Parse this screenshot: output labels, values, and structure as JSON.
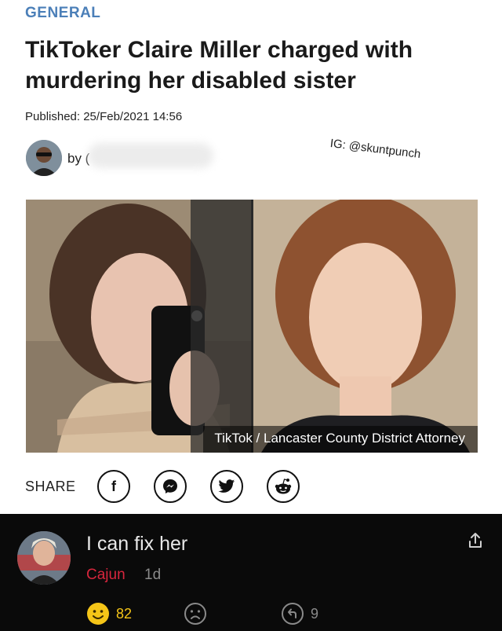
{
  "article": {
    "category": "GENERAL",
    "headline": "TikToker Claire Miller charged with murdering her disabled sister",
    "published": "Published: 25/Feb/2021 14:56",
    "byline": "by (",
    "watermark": "IG: @skuntpunch",
    "photo_caption": "TikTok / Lancaster County District Attorney"
  },
  "share": {
    "label": "SHARE",
    "buttons": [
      {
        "icon": "facebook-icon",
        "glyph": "f"
      },
      {
        "icon": "messenger-icon"
      },
      {
        "icon": "twitter-icon"
      },
      {
        "icon": "reddit-icon"
      }
    ]
  },
  "comment": {
    "text": "I can fix her",
    "username": "Cajun",
    "time": "1d",
    "upvotes": "82",
    "replies": "9"
  },
  "colors": {
    "category": "#4b7fb8",
    "username": "#d7263d",
    "upvote_emoji": "#f5c518",
    "comments_bg": "#0a0a0a"
  }
}
